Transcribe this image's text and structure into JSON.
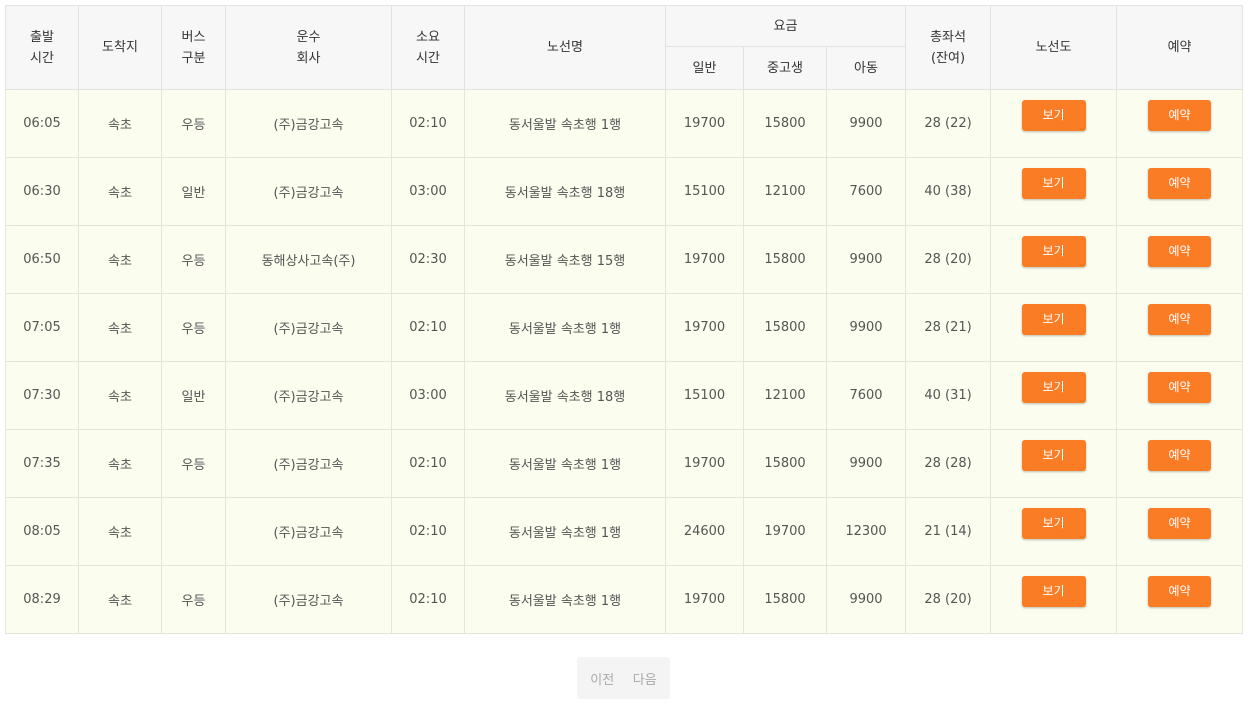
{
  "header": {
    "departure_time": [
      "출발",
      "시간"
    ],
    "destination": "도착지",
    "bus_type": [
      "버스",
      "구분"
    ],
    "company": [
      "운수",
      "회사"
    ],
    "duration": [
      "소요",
      "시간"
    ],
    "route_name": "노선명",
    "fare": "요금",
    "fare_adult": "일반",
    "fare_student": "중고생",
    "fare_child": "아동",
    "seats": [
      "총좌석",
      "(잔여)"
    ],
    "route_map": "노선도",
    "reservation": "예약"
  },
  "rows": [
    {
      "time": "06:05",
      "dest": "속초",
      "type": "우등",
      "company": "(주)금강고속",
      "duration": "02:10",
      "route": "동서울발 속초행 1행",
      "adult": "19700",
      "student": "15800",
      "child": "9900",
      "seats": "28 (22)",
      "view": "보기",
      "book": "예약"
    },
    {
      "time": "06:30",
      "dest": "속초",
      "type": "일반",
      "company": "(주)금강고속",
      "duration": "03:00",
      "route": "동서울발 속초행 18행",
      "adult": "15100",
      "student": "12100",
      "child": "7600",
      "seats": "40 (38)",
      "view": "보기",
      "book": "예약"
    },
    {
      "time": "06:50",
      "dest": "속초",
      "type": "우등",
      "company": "동해상사고속(주)",
      "duration": "02:30",
      "route": "동서울발 속초행 15행",
      "adult": "19700",
      "student": "15800",
      "child": "9900",
      "seats": "28 (20)",
      "view": "보기",
      "book": "예약"
    },
    {
      "time": "07:05",
      "dest": "속초",
      "type": "우등",
      "company": "(주)금강고속",
      "duration": "02:10",
      "route": "동서울발 속초행 1행",
      "adult": "19700",
      "student": "15800",
      "child": "9900",
      "seats": "28 (21)",
      "view": "보기",
      "book": "예약"
    },
    {
      "time": "07:30",
      "dest": "속초",
      "type": "일반",
      "company": "(주)금강고속",
      "duration": "03:00",
      "route": "동서울발 속초행 18행",
      "adult": "15100",
      "student": "12100",
      "child": "7600",
      "seats": "40 (31)",
      "view": "보기",
      "book": "예약"
    },
    {
      "time": "07:35",
      "dest": "속초",
      "type": "우등",
      "company": "(주)금강고속",
      "duration": "02:10",
      "route": "동서울발 속초행 1행",
      "adult": "19700",
      "student": "15800",
      "child": "9900",
      "seats": "28 (28)",
      "view": "보기",
      "book": "예약"
    },
    {
      "time": "08:05",
      "dest": "속초",
      "type": "",
      "company": "(주)금강고속",
      "duration": "02:10",
      "route": "동서울발 속초행 1행",
      "adult": "24600",
      "student": "19700",
      "child": "12300",
      "seats": "21 (14)",
      "view": "보기",
      "book": "예약"
    },
    {
      "time": "08:29",
      "dest": "속초",
      "type": "우등",
      "company": "(주)금강고속",
      "duration": "02:10",
      "route": "동서울발 속초행 1행",
      "adult": "19700",
      "student": "15800",
      "child": "9900",
      "seats": "28 (20)",
      "view": "보기",
      "book": "예약"
    }
  ],
  "pagination": {
    "prev": "이전",
    "next": "다음"
  },
  "colors": {
    "button": "#fa7d26",
    "row_bg": "#fbfdef",
    "header_bg": "#f7f7f7"
  }
}
